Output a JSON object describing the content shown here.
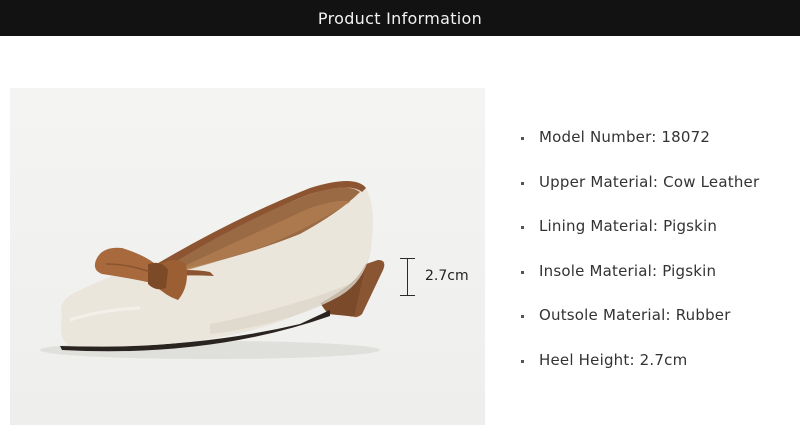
{
  "header": {
    "title": "Product Information",
    "background": "#121212"
  },
  "product_image": {
    "alt": "beige leather flat shoe with brown bow and brown heel",
    "colors": {
      "leather": "#ebe6dc",
      "trim": "#8c5430",
      "bow": "#a86a3c",
      "heel": "#7a4a2a"
    }
  },
  "measurement": {
    "label": "2.7cm"
  },
  "specs": [
    {
      "label": "Model Number: 18072"
    },
    {
      "label": "Upper Material: Cow Leather"
    },
    {
      "label": "Lining Material: Pigskin"
    },
    {
      "label": "Insole Material: Pigskin"
    },
    {
      "label": "Outsole Material: Rubber"
    },
    {
      "label": "Heel Height: 2.7cm"
    }
  ]
}
